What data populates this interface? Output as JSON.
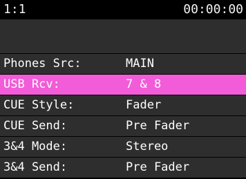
{
  "status": {
    "left": "1:1",
    "time": "00:00:00"
  },
  "menu": {
    "items": [
      {
        "label": "Phones Src:",
        "value": "MAIN",
        "selected": false
      },
      {
        "label": "USB Rcv:",
        "value": "7 & 8",
        "selected": true
      },
      {
        "label": "CUE Style:",
        "value": "Fader",
        "selected": false
      },
      {
        "label": "CUE Send:",
        "value": "Pre Fader",
        "selected": false
      },
      {
        "label": "3&4 Mode:",
        "value": "Stereo",
        "selected": false
      },
      {
        "label": "3&4 Send:",
        "value": "Pre Fader",
        "selected": false
      }
    ]
  },
  "colors": {
    "background": "#000000",
    "row_background": "#2e2e2e",
    "selected_row": "#f25cd8",
    "text": "#ffffff"
  }
}
